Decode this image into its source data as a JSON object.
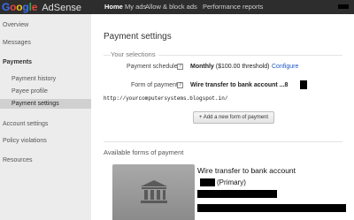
{
  "header": {
    "logo_google": "Google",
    "logo_product": "AdSense",
    "nav": [
      {
        "label": "Home"
      },
      {
        "label": "My ads"
      },
      {
        "label": "Allow & block ads"
      },
      {
        "label": "Performance reports"
      }
    ],
    "logo_colors": {
      "G": "#3b6ef0",
      "o1": "#e8453c",
      "o2": "#f4c20d",
      "g": "#3b6ef0",
      "l": "#34a853",
      "e": "#e8453c"
    }
  },
  "sidebar": {
    "items": [
      {
        "label": "Overview"
      },
      {
        "label": "Messages"
      },
      {
        "label": "Payments"
      },
      {
        "label": "Payment history"
      },
      {
        "label": "Payee profile"
      },
      {
        "label": "Payment settings"
      },
      {
        "label": "Account settings"
      },
      {
        "label": "Policy violations"
      },
      {
        "label": "Resources"
      }
    ]
  },
  "main": {
    "title": "Payment settings",
    "selections_label": "Your selections",
    "schedule": {
      "label": "Payment schedule",
      "help": "?",
      "value_bold": "Monthly",
      "value_rest": "($100.00 threshold)",
      "link": "Configure"
    },
    "form": {
      "label": "Form of payment",
      "help": "?",
      "value": "Wire transfer to bank account ...8"
    },
    "url": "http://yourcomputersystems.blogspot.in/",
    "add_button": "+ Add a new form of payment",
    "available_label": "Available forms of payment",
    "card": {
      "title": "Wire transfer to bank account",
      "primary": "(Primary)",
      "icon": "bank-building-icon"
    }
  }
}
